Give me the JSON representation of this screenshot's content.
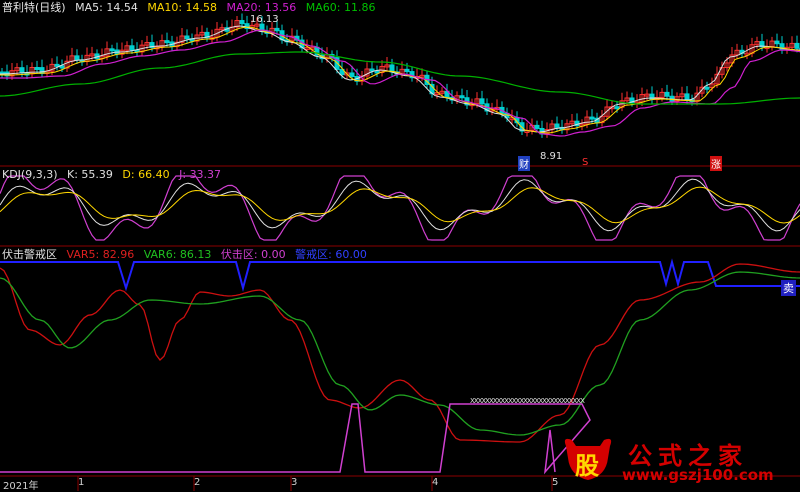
{
  "colors": {
    "background": "#000000",
    "divider": "#8b0000",
    "ma5": "#e0e0e0",
    "ma10": "#ffd700",
    "ma20": "#d020d0",
    "ma60": "#00b000",
    "candle_up": "#ff3030",
    "candle_down": "#00d0d0",
    "kdj_k": "#e0e0e0",
    "kdj_d": "#ffd700",
    "kdj_j": "#d040d0",
    "var5": "#cc1010",
    "var6": "#20a020",
    "ambush": "#d040d0",
    "alert": "#2020ff",
    "watermark": "#d40000"
  },
  "main_panel": {
    "stock_name": "普利特(日线)",
    "ma5": {
      "label": "MA5:",
      "value": "14.54"
    },
    "ma10": {
      "label": "MA10:",
      "value": "14.58"
    },
    "ma20": {
      "label": "MA20:",
      "value": "13.56"
    },
    "ma60": {
      "label": "MA60:",
      "value": "11.86"
    },
    "high_marker": "16.13",
    "low_marker": "8.91",
    "marker_cai": "财",
    "marker_s": "S",
    "marker_zhang": "涨"
  },
  "kdj_panel": {
    "name": "KDJ(9,3,3)",
    "k": {
      "label": "K:",
      "value": "55.39"
    },
    "d": {
      "label": "D:",
      "value": "66.40"
    },
    "j": {
      "label": "J:",
      "value": "33.37"
    }
  },
  "alert_panel": {
    "name": "伏击警戒区",
    "var5": {
      "label": "VAR5:",
      "value": "82.96"
    },
    "var6": {
      "label": "VAR6:",
      "value": "86.13"
    },
    "ambush": {
      "label": "伏击区:",
      "value": "0.00"
    },
    "alert": {
      "label": "警戒区:",
      "value": "60.00"
    },
    "sell_marker": "卖",
    "hatch_text": "XXXXXXXXXXXXXXXXXXXXXXXXXXXXXX"
  },
  "time_axis": {
    "year": "2021年",
    "months": [
      "1",
      "2",
      "3",
      "4",
      "5"
    ]
  },
  "watermark": {
    "logo_char": "股",
    "name": "公式之家",
    "url": "www.gszj100.com"
  }
}
